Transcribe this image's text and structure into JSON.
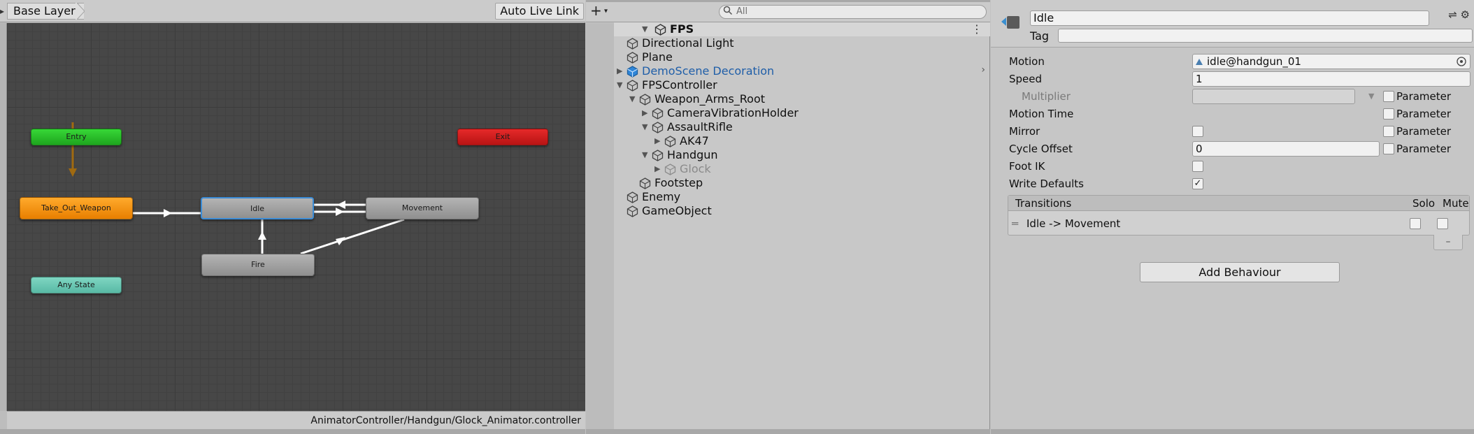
{
  "animator": {
    "layer_label": "Base Layer",
    "live_link_label": "Auto Live Link",
    "status_path": "AnimatorController/Handgun/Glock_Animator.controller",
    "nodes": {
      "entry": "Entry",
      "exit": "Exit",
      "take_out": "Take_Out_Weapon",
      "idle": "Idle",
      "movement": "Movement",
      "fire": "Fire",
      "any_state": "Any State"
    },
    "colors": {
      "entry": "#27bd27",
      "exit": "#d01d1d",
      "take_out": "#f59a10",
      "selected_outline": "#3b8cd6",
      "any_state": "#6cc8b4",
      "default_transition": "#a06a10"
    }
  },
  "hierarchy": {
    "search_placeholder": "All",
    "scene_name": "FPS",
    "items": [
      {
        "label": "Directional Light",
        "depth": 1,
        "expander": "none"
      },
      {
        "label": "Plane",
        "depth": 1,
        "expander": "none"
      },
      {
        "label": "DemoScene Decoration",
        "depth": 1,
        "expander": "collapsed",
        "prefab": true
      },
      {
        "label": "FPSController",
        "depth": 1,
        "expander": "expanded"
      },
      {
        "label": "Weapon_Arms_Root",
        "depth": 2,
        "expander": "expanded"
      },
      {
        "label": "CameraVibrationHolder",
        "depth": 3,
        "expander": "collapsed"
      },
      {
        "label": "AssaultRifle",
        "depth": 3,
        "expander": "expanded"
      },
      {
        "label": "AK47",
        "depth": 4,
        "expander": "collapsed"
      },
      {
        "label": "Handgun",
        "depth": 3,
        "expander": "expanded"
      },
      {
        "label": "Glock",
        "depth": 4,
        "expander": "collapsed",
        "disabled": true
      },
      {
        "label": "Footstep",
        "depth": 2,
        "expander": "none"
      },
      {
        "label": "Enemy",
        "depth": 1,
        "expander": "none"
      },
      {
        "label": "GameObject",
        "depth": 1,
        "expander": "none"
      }
    ],
    "colors": {
      "prefab_text": "#1f5ea8",
      "disabled_text": "#8a8a8a"
    }
  },
  "inspector": {
    "state_name": "Idle",
    "tag_label": "Tag",
    "tag_value": "",
    "motion_label": "Motion",
    "motion_value": "idle@handgun_01",
    "speed_label": "Speed",
    "speed_value": "1",
    "multiplier_label": "Multiplier",
    "motion_time_label": "Motion Time",
    "mirror_label": "Mirror",
    "cycle_offset_label": "Cycle Offset",
    "cycle_offset_value": "0",
    "foot_ik_label": "Foot IK",
    "write_defaults_label": "Write Defaults",
    "write_defaults_check": "✓",
    "parameter_label": "Parameter",
    "transitions_label": "Transitions",
    "solo_label": "Solo",
    "mute_label": "Mute",
    "transition_item": "Idle -> Movement",
    "minus_label": "–",
    "add_behaviour_label": "Add Behaviour"
  }
}
